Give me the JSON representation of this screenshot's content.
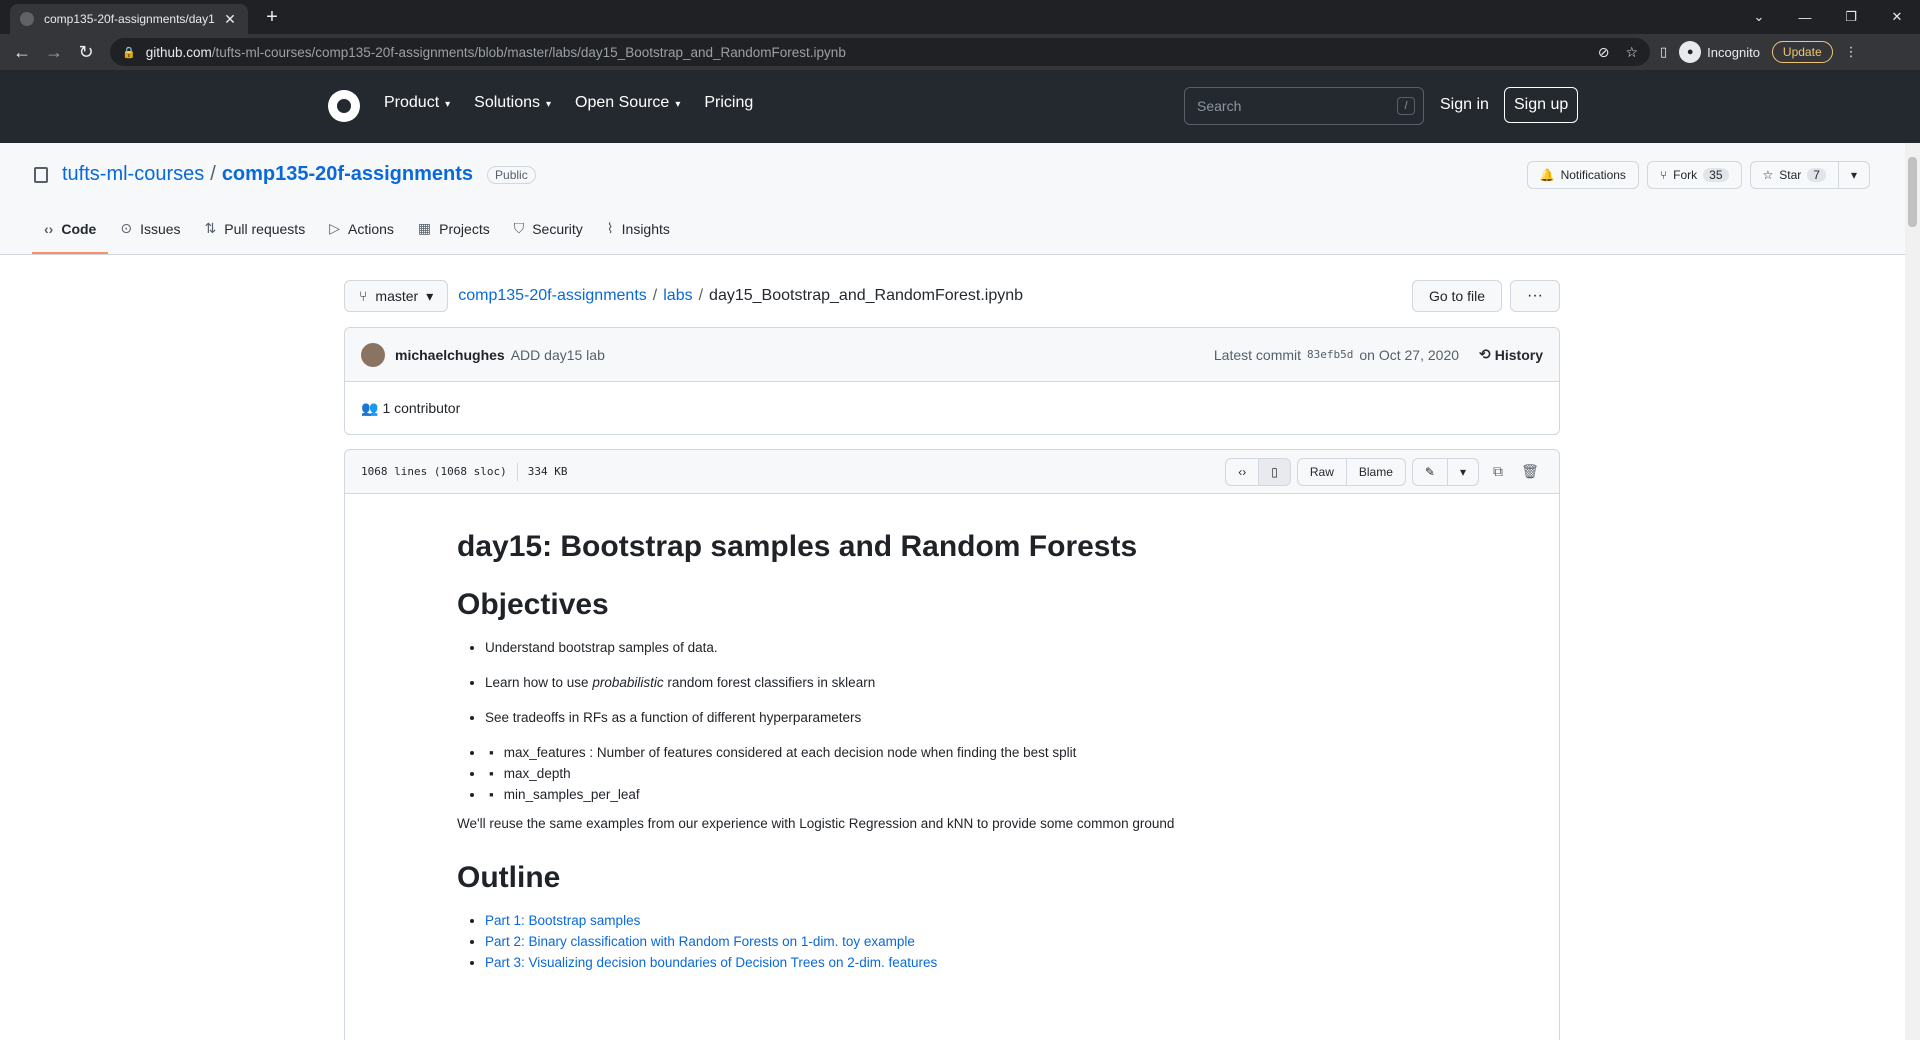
{
  "browser": {
    "tab_title": "comp135-20f-assignments/day1",
    "url_host": "github.com",
    "url_path": "/tufts-ml-courses/comp135-20f-assignments/blob/master/labs/day15_Bootstrap_and_RandomForest.ipynb",
    "profile_label": "Incognito",
    "update_label": "Update"
  },
  "gh_header": {
    "nav": [
      "Product",
      "Solutions",
      "Open Source",
      "Pricing"
    ],
    "search_placeholder": "Search",
    "search_shortcut": "/",
    "signin": "Sign in",
    "signup": "Sign up"
  },
  "repo": {
    "owner": "tufts-ml-courses",
    "name": "comp135-20f-assignments",
    "visibility": "Public",
    "notifications_label": "Notifications",
    "fork_label": "Fork",
    "fork_count": "35",
    "star_label": "Star",
    "star_count": "7",
    "tabs": [
      "Code",
      "Issues",
      "Pull requests",
      "Actions",
      "Projects",
      "Security",
      "Insights"
    ]
  },
  "file": {
    "branch": "master",
    "crumb_repo": "comp135-20f-assignments",
    "crumb_dir": "labs",
    "crumb_file": "day15_Bootstrap_and_RandomForest.ipynb",
    "goto_label": "Go to file",
    "commit_author": "michaelchughes",
    "commit_message": "ADD day15 lab",
    "latest_commit_label": "Latest commit",
    "commit_sha": "83efb5d",
    "commit_date": "on Oct 27, 2020",
    "history_label": "History",
    "contributors": "1 contributor",
    "lines": "1068 lines (1068 sloc)",
    "size": "334 KB",
    "raw_label": "Raw",
    "blame_label": "Blame"
  },
  "notebook": {
    "title": "day15: Bootstrap samples and Random Forests",
    "objectives_heading": "Objectives",
    "obj_1": "Understand bootstrap samples of data.",
    "obj_2_pre": "Learn how to use ",
    "obj_2_em": "probabilistic",
    "obj_2_post": " random forest classifiers in sklearn",
    "obj_3": "See tradeoffs in RFs as a function of different hyperparameters",
    "hp_1": "max_features : Number of features considered at each decision node when finding the best split",
    "hp_2": "max_depth",
    "hp_3": "min_samples_per_leaf",
    "reuse": "We'll reuse the same examples from our experience with Logistic Regression and kNN to provide some common ground",
    "outline_heading": "Outline",
    "part_1": "Part 1: Bootstrap samples",
    "part_2": "Part 2: Binary classification with Random Forests on 1-dim. toy example",
    "part_3": "Part 3: Visualizing decision boundaries of Decision Trees on 2-dim. features"
  }
}
